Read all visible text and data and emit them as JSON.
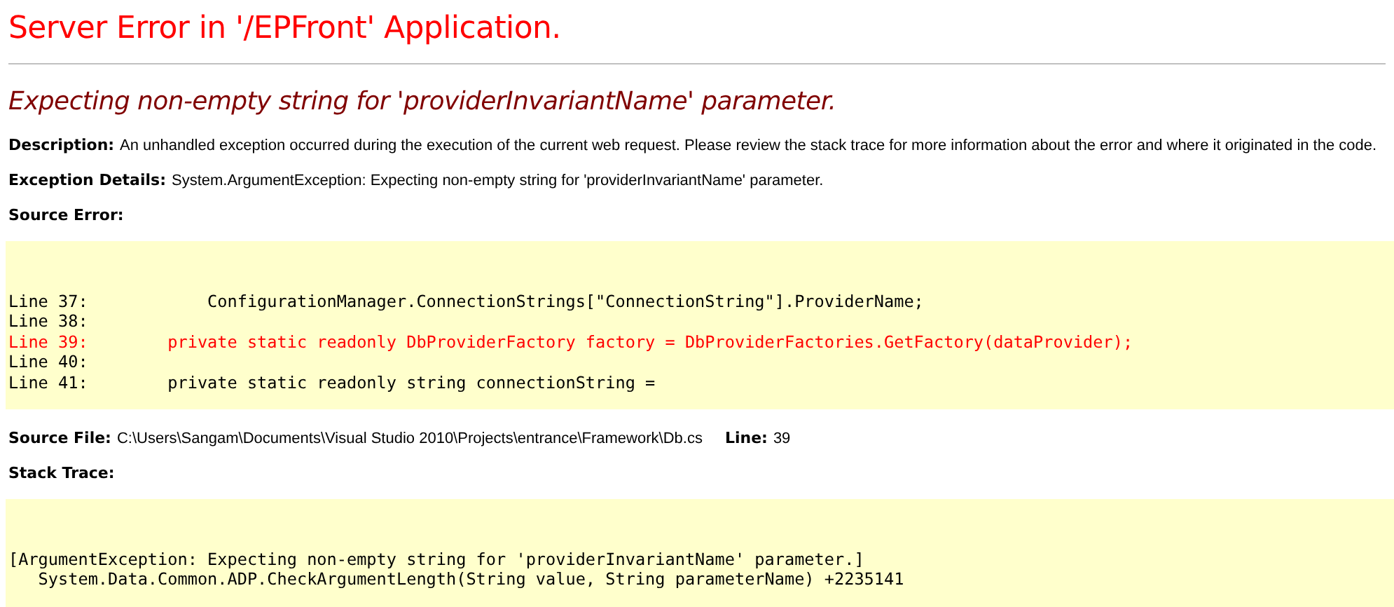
{
  "title": "Server Error in '/EPFront' Application.",
  "error_heading": "Expecting non-empty string for 'providerInvariantName' parameter.",
  "description": {
    "label": "Description:",
    "text": "An unhandled exception occurred during the execution of the current web request. Please review the stack trace for more information about the error and where it originated in the code."
  },
  "exception_details": {
    "label": "Exception Details:",
    "text": "System.ArgumentException: Expecting non-empty string for 'providerInvariantName' parameter."
  },
  "source_error": {
    "label": "Source Error:",
    "lines": [
      {
        "text": "Line 37:            ConfigurationManager.ConnectionStrings[\"ConnectionString\"].ProviderName;",
        "highlighted": false
      },
      {
        "text": "Line 38:",
        "highlighted": false
      },
      {
        "text": "Line 39:        private static readonly DbProviderFactory factory = DbProviderFactories.GetFactory(dataProvider);",
        "highlighted": true
      },
      {
        "text": "Line 40:",
        "highlighted": false
      },
      {
        "text": "Line 41:        private static readonly string connectionString =",
        "highlighted": false
      }
    ]
  },
  "source_file": {
    "label": "Source File:",
    "path": "C:\\Users\\Sangam\\Documents\\Visual Studio 2010\\Projects\\entrance\\Framework\\Db.cs",
    "line_label": "Line:",
    "line": "39"
  },
  "stack_trace": {
    "label": "Stack Trace:",
    "lines": [
      "[ArgumentException: Expecting non-empty string for 'providerInvariantName' parameter.]",
      "   System.Data.Common.ADP.CheckArgumentLength(String value, String parameterName) +2235141"
    ]
  }
}
